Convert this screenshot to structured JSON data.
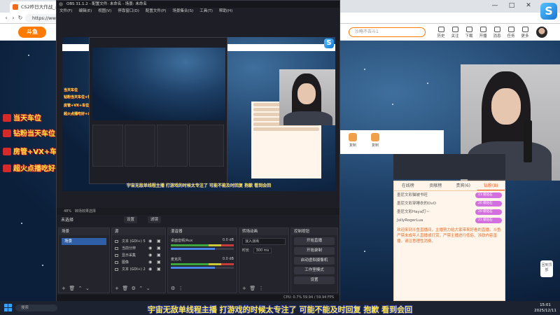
{
  "browser": {
    "tab_title": "CS2昨日大作战_斗鱼直播",
    "url": "https://www.do",
    "window_controls": [
      "—",
      "□",
      "✕"
    ]
  },
  "site": {
    "logo_text": "斗鱼",
    "search_placeholder": "沙略不去斗1",
    "header_icons": [
      "历史",
      "关注",
      "下载",
      "开播",
      "消息",
      "任务",
      "更多"
    ],
    "overlay_texts": [
      "当天车位",
      "钻粉当天车位+钻粉群",
      "房管+VX+车位",
      "超火点播吃好+以上"
    ],
    "gift_items": [
      "复制",
      "复制"
    ],
    "chat_tabs": [
      "在线榜",
      "贡献榜",
      "贵宾(6)",
      "钻粉(8)"
    ],
    "chat_rank": [
      {
        "name": "墨尼文彩猫被书旺",
        "badge": "23 级钻石"
      },
      {
        "name": "墨尼文彩穿睡衣的OvO",
        "badge": "20 级钻石"
      },
      {
        "name": "墨尼文彩Haya訂~",
        "badge": "20 级钻石"
      },
      {
        "name": "JollyRogerLua",
        "badge": "21 级钻石"
      }
    ],
    "chat_notice": "欢迎来到斗鱼直播间，主播努力给大家带来好看的直播。斗鱼严禁未成年人直播或打赏，严禁主播进行低俗、涉政内容直播，请注意理性消费。",
    "side_float_label": "回到顶部"
  },
  "obs": {
    "title": "OBS 31.1.2 - 配置文件: 未命名 - 场景: 未命名",
    "menu": [
      "文件(F)",
      "编辑(E)",
      "视图(V)",
      "停靠窗口(D)",
      "配置文件(P)",
      "场景集合(S)",
      "工具(T)",
      "帮助(H)"
    ],
    "status_left": "48%",
    "status_mid": "转场效果选择",
    "scene_label": "未选择",
    "top_btns": [
      "设置",
      "滤镜"
    ],
    "docks": {
      "scenes": "场景",
      "sources": "源",
      "mixer": "混音器",
      "transitions": "转场动画",
      "controls": "控制按钮"
    },
    "scene_items": [
      "场景"
    ],
    "sources": [
      "文本 (GDI+) 5",
      "当前分辨",
      "显示采集",
      "图像",
      "文本 (GDI+) 2"
    ],
    "mixer": [
      {
        "name": "桌面音频/Aux",
        "db": "0.0 dB"
      },
      {
        "name": "麦克风",
        "db": "0.0 dB"
      }
    ],
    "transition": {
      "type": "淡入淡出",
      "duration_label": "时长",
      "duration": "300 ms"
    },
    "controls": [
      "开始直播",
      "开始录制",
      "启动虚拟摄像机",
      "工作室模式",
      "设置",
      "退出"
    ],
    "bottom_status": "CPU: 0.7%  59.94 / 59.94 FPS",
    "nested_subtitle": "宇宙无敌单线程主播 打游戏的时候太专注了 可能不能及时回复 抱歉 看到会回"
  },
  "subtitle": "宇宙无敌单线程主播 打游戏的时候太专注了 可能不能及时回复 抱歉 看到会回",
  "taskbar": {
    "search": "搜索",
    "time": "15:01",
    "date": "2025/12/11"
  },
  "logo_letter": "S"
}
